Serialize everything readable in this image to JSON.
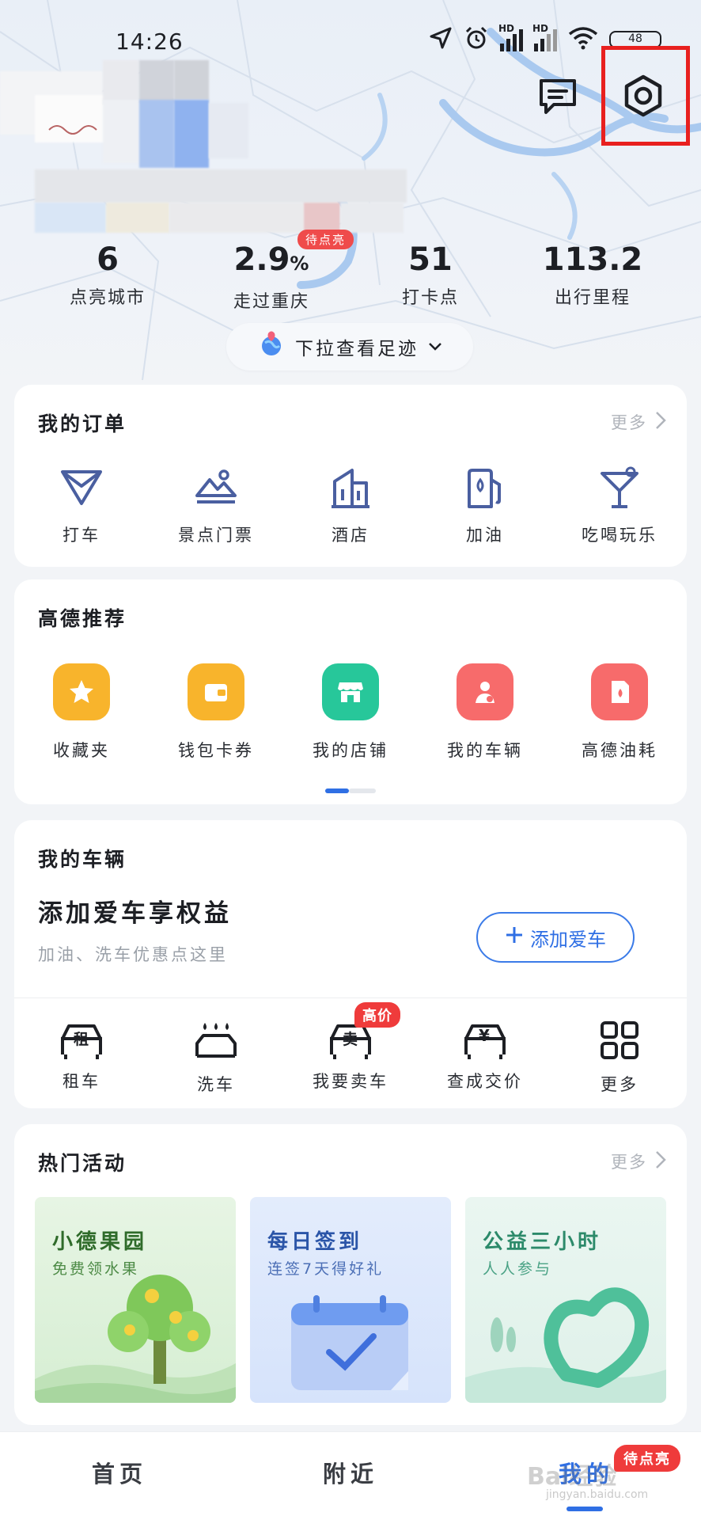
{
  "status_bar": {
    "time": "14:26",
    "signal1_label": "HD",
    "signal2_label": "HD",
    "battery": "48"
  },
  "header": {
    "message_icon": "message-icon",
    "settings_icon": "settings-icon"
  },
  "stats": [
    {
      "value": "6",
      "label": "点亮城市"
    },
    {
      "value": "2.9",
      "unit": "%",
      "label": "走过重庆",
      "badge": "待点亮"
    },
    {
      "value": "51",
      "label": "打卡点"
    },
    {
      "value": "113.2",
      "label": "出行里程"
    }
  ],
  "pull_hint": "下拉查看足迹",
  "orders": {
    "title": "我的订单",
    "more": "更多",
    "items": [
      {
        "label": "打车",
        "icon": "taxi-icon"
      },
      {
        "label": "景点门票",
        "icon": "scenic-icon"
      },
      {
        "label": "酒店",
        "icon": "hotel-icon"
      },
      {
        "label": "加油",
        "icon": "fuel-icon"
      },
      {
        "label": "吃喝玩乐",
        "icon": "cocktail-icon"
      }
    ]
  },
  "recommend": {
    "title": "高德推荐",
    "items": [
      {
        "label": "收藏夹",
        "icon": "star-icon",
        "color": "#f8b42c"
      },
      {
        "label": "钱包卡券",
        "icon": "wallet-icon",
        "color": "#f8b42c"
      },
      {
        "label": "我的店铺",
        "icon": "store-icon",
        "color": "#27c79a"
      },
      {
        "label": "我的车辆",
        "icon": "driver-icon",
        "color": "#f76b6b"
      },
      {
        "label": "高德油耗",
        "icon": "fuel-can-icon",
        "color": "#f76b6b"
      }
    ]
  },
  "vehicle": {
    "title": "我的车辆",
    "headline": "添加爱车享权益",
    "subline": "加油、洗车优惠点这里",
    "add_button": "添加爱车",
    "items": [
      {
        "label": "租车",
        "icon": "rent-car-icon",
        "glyph": "租"
      },
      {
        "label": "洗车",
        "icon": "car-wash-icon"
      },
      {
        "label": "我要卖车",
        "icon": "sell-car-icon",
        "glyph": "卖",
        "badge": "高价"
      },
      {
        "label": "查成交价",
        "icon": "price-car-icon",
        "glyph": "¥"
      },
      {
        "label": "更多",
        "icon": "grid-icon"
      }
    ]
  },
  "activities": {
    "title": "热门活动",
    "more": "更多",
    "tiles": [
      {
        "title": "小德果园",
        "subtitle": "免费领水果"
      },
      {
        "title": "每日签到",
        "subtitle": "连签7天得好礼"
      },
      {
        "title": "公益三小时",
        "subtitle": "人人参与"
      }
    ]
  },
  "bottom_nav": {
    "items": [
      "首页",
      "附近",
      "我的"
    ],
    "active_index": 2,
    "badge": "待点亮"
  },
  "watermark": {
    "main": "Bai经验",
    "sub": "jingyan.baidu.com"
  },
  "colors": {
    "accent": "#2f6fe4",
    "badge_red": "#ef3b3b",
    "highlight_box": "#e8201f"
  }
}
